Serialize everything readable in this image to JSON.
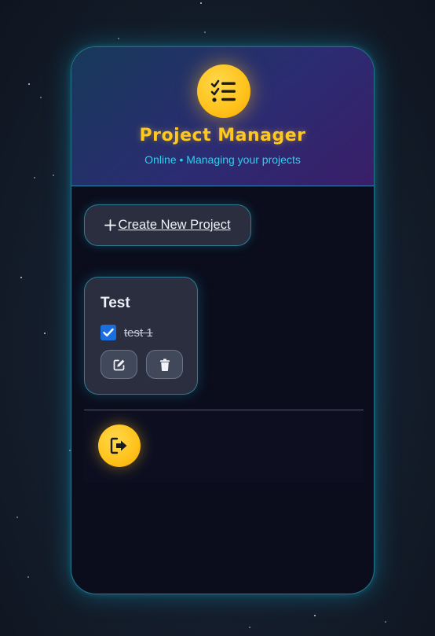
{
  "app": {
    "title": "Project Manager",
    "subtitle": "Online • Managing your projects",
    "logo_icon": "task-list-icon"
  },
  "actions": {
    "create_label": "Create New Project",
    "create_icon": "plus-icon"
  },
  "projects": [
    {
      "title": "Test",
      "tasks": [
        {
          "label": "test 1",
          "completed": true
        }
      ],
      "edit_icon": "edit-icon",
      "delete_icon": "trash-icon"
    }
  ],
  "footer": {
    "logout_icon": "logout-icon"
  },
  "colors": {
    "accent_yellow": "#ffc81e",
    "accent_cyan": "#27d3ee",
    "card_bg": "#0b0d1c",
    "panel_bg": "#2b2e3e",
    "checkbox_blue": "#1a6fe0"
  }
}
